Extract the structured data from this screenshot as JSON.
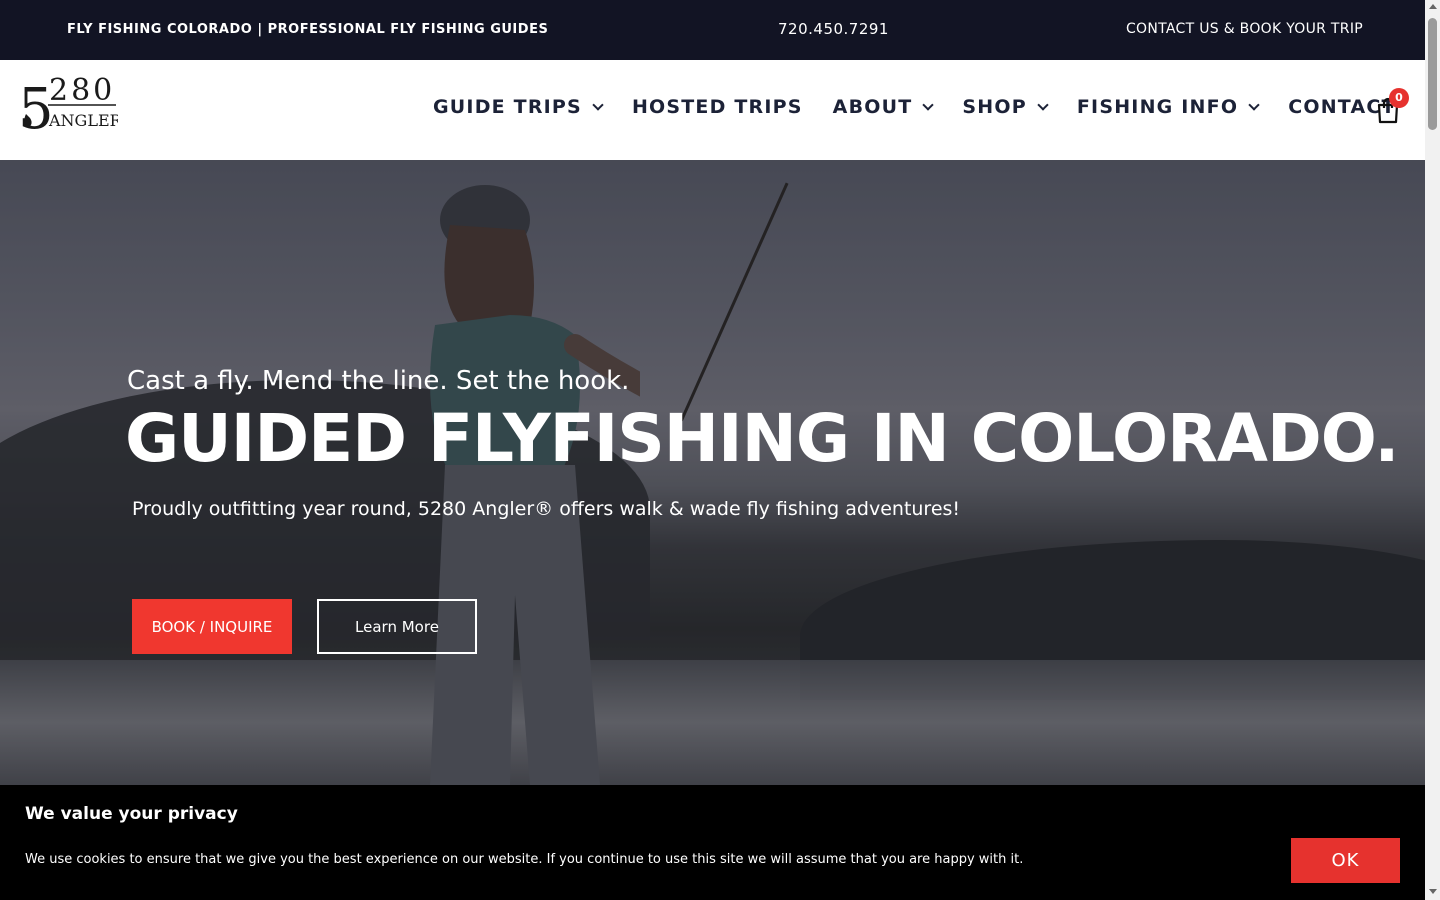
{
  "topbar": {
    "tagline": "FLY FISHING COLORADO | PROFESSIONAL FLY FISHING GUIDES",
    "phone": "720.450.7291",
    "contact_link": "CONTACT US & BOOK YOUR TRIP"
  },
  "logo": {
    "number": "280",
    "big_digit": "5",
    "word": "ANGLER"
  },
  "nav": {
    "items": [
      {
        "label": "GUIDE TRIPS",
        "has_dropdown": true
      },
      {
        "label": "HOSTED TRIPS",
        "has_dropdown": false
      },
      {
        "label": "ABOUT",
        "has_dropdown": true
      },
      {
        "label": "SHOP",
        "has_dropdown": true
      },
      {
        "label": "FISHING INFO",
        "has_dropdown": true
      },
      {
        "label": "CONTACT",
        "has_dropdown": false
      }
    ],
    "cart_icon": "shopping-bag-icon",
    "cart_count": "0"
  },
  "hero": {
    "kicker": "Cast a fly. Mend the line. Set the hook.",
    "headline": "GUIDED FLYFISHING IN COLORADO.",
    "subline": "Proudly outfitting year round, 5280 Angler® offers walk & wade fly fishing adventures!",
    "book_button": "BOOK / INQUIRE",
    "learn_button": "Learn More"
  },
  "cookie": {
    "title": "We value your privacy",
    "text": "We use cookies to ensure that we give you the best experience on our website. If you continue to use this site we will assume that you are happy with it.",
    "ok_button": "OK"
  },
  "colors": {
    "topbar_bg": "#121424",
    "nav_text": "#1c2237",
    "accent_red": "#f0372f",
    "cookie_bg": "#000000"
  }
}
